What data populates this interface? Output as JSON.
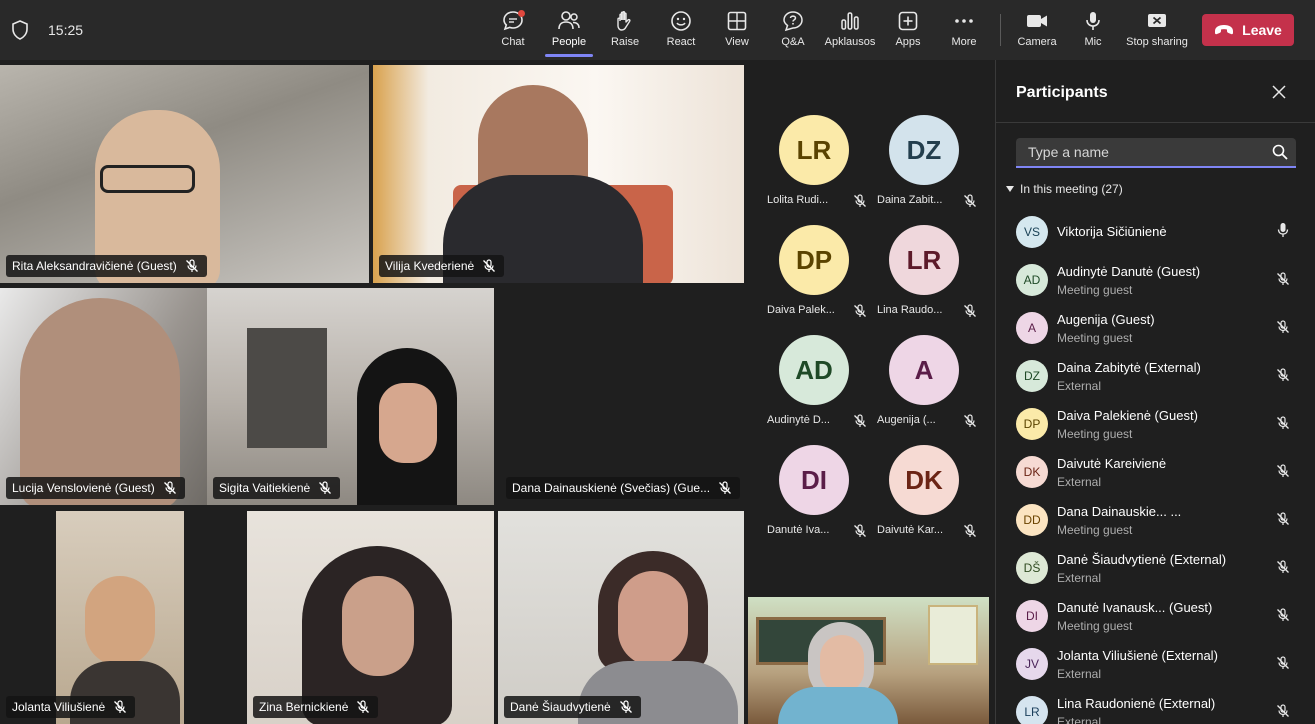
{
  "topbar": {
    "time": "15:25",
    "buttons": {
      "chat": "Chat",
      "people": "People",
      "raise": "Raise",
      "react": "React",
      "view": "View",
      "qa": "Q&A",
      "polls": "Apklausos",
      "apps": "Apps",
      "more": "More",
      "camera": "Camera",
      "mic": "Mic",
      "stop_sharing": "Stop sharing"
    },
    "leave": "Leave"
  },
  "videos": {
    "rita": "Rita Aleksandravičienė (Guest)",
    "vilija": "Vilija Kvederienė",
    "lucija": "Lucija Venslovienė (Guest)",
    "sigita": "Sigita Vaitiekienė",
    "dana": "Dana Dainauskienė (Svečias) (Gue...",
    "jolanta": "Jolanta Viliušienė",
    "zina": "Zina Bernickienė",
    "dane": "Danė Šiaudvytienė"
  },
  "avatars": [
    {
      "initials": "LR",
      "name": "Lolita Rudi...",
      "bg": "#fbeaa9",
      "fg": "#5a4300"
    },
    {
      "initials": "DZ",
      "name": "Daina Zabit...",
      "bg": "#d3e3ec",
      "fg": "#233e4d"
    },
    {
      "initials": "DP",
      "name": "Daiva Palek...",
      "bg": "#fbeaa9",
      "fg": "#5a4300"
    },
    {
      "initials": "LR",
      "name": "Lina Raudo...",
      "bg": "#efd7dc",
      "fg": "#5c1a2a"
    },
    {
      "initials": "AD",
      "name": "Audinytė D...",
      "bg": "#d7e9da",
      "fg": "#1f4a27"
    },
    {
      "initials": "A",
      "name": "Augenija (...",
      "bg": "#eed6e6",
      "fg": "#5a1d48"
    },
    {
      "initials": "DI",
      "name": "Danutė Iva...",
      "bg": "#eed6e6",
      "fg": "#5a1d48"
    },
    {
      "initials": "DK",
      "name": "Daivutė Kar...",
      "bg": "#f6dad3",
      "fg": "#6b2415"
    }
  ],
  "panel": {
    "title": "Participants",
    "search_placeholder": "Type a name",
    "section": "In this meeting (27)",
    "participants": [
      {
        "initials": "VS",
        "name": "Viktorija Sičiūnienė",
        "sub": "",
        "bg": "#d5e8ef",
        "fg": "#1b4256",
        "mic": "on"
      },
      {
        "initials": "AD",
        "name": "Audinytė Danutė (Guest)",
        "sub": "Meeting guest",
        "bg": "#d7e9da",
        "fg": "#1f4a27",
        "mic": "off"
      },
      {
        "initials": "A",
        "name": "Augenija (Guest)",
        "sub": "Meeting guest",
        "bg": "#eed6e6",
        "fg": "#5a1d48",
        "mic": "off"
      },
      {
        "initials": "DZ",
        "name": "Daina Zabitytė (External)",
        "sub": "External",
        "bg": "#d7e9da",
        "fg": "#1f4a27",
        "mic": "off"
      },
      {
        "initials": "DP",
        "name": "Daiva Palekienė (Guest)",
        "sub": "Meeting guest",
        "bg": "#fbeaa9",
        "fg": "#5a4300",
        "mic": "off"
      },
      {
        "initials": "DK",
        "name": "Daivutė Kareivienė",
        "sub": "External",
        "bg": "#f6dad3",
        "fg": "#6b2415",
        "mic": "off"
      },
      {
        "initials": "DD",
        "name": "Dana Dainauskie... ...",
        "sub": "Meeting guest",
        "bg": "#fbe4c1",
        "fg": "#6a4300",
        "mic": "off"
      },
      {
        "initials": "DŠ",
        "name": "Danė Šiaudvytienė (External)",
        "sub": "External",
        "bg": "#dde8d5",
        "fg": "#2f4a20",
        "mic": "off"
      },
      {
        "initials": "DI",
        "name": "Danutė Ivanausk... (Guest)",
        "sub": "Meeting guest",
        "bg": "#eed6e6",
        "fg": "#5a1d48",
        "mic": "off"
      },
      {
        "initials": "JV",
        "name": "Jolanta Viliušienė (External)",
        "sub": "External",
        "bg": "#e6d8ec",
        "fg": "#4a2459",
        "mic": "off"
      },
      {
        "initials": "LR",
        "name": "Lina Raudonienė (External)",
        "sub": "External",
        "bg": "#d5e4ef",
        "fg": "#1b3f5c",
        "mic": "off"
      }
    ]
  }
}
